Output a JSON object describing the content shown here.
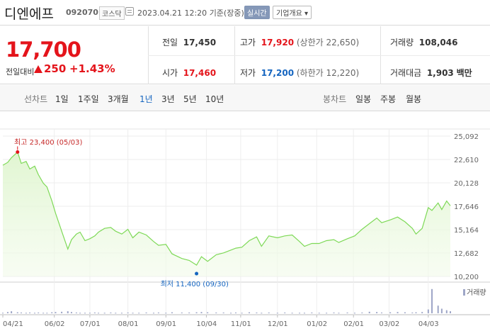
{
  "header": {
    "name": "디엔에프",
    "code": "092070",
    "market": "코스닥",
    "datetime": "2023.04.21 12:20",
    "basis": "기준(장중)",
    "live_label": "실시간",
    "info_label": "기업개요 ▾"
  },
  "quote": {
    "price": "17,700",
    "change_label": "전일대비",
    "change": "250",
    "change_pct": "+1.43%",
    "prev_label": "전일",
    "prev": "17,450",
    "high_label": "고가",
    "high": "17,920",
    "upper_limit": "(상한가 22,650)",
    "volume_label": "거래량",
    "volume": "108,046",
    "open_label": "시가",
    "open": "17,460",
    "low_label": "저가",
    "low": "17,200",
    "lower_limit": "(하한가 12,220)",
    "amount_label": "거래대금",
    "amount": "1,903",
    "amount_unit": "백만"
  },
  "tabs": {
    "line_label": "선차트",
    "periods": [
      "1일",
      "1주일",
      "3개월",
      "1년",
      "3년",
      "5년",
      "10년"
    ],
    "selected": "1년",
    "candle_label": "봉차트",
    "candles": [
      "일봉",
      "주봉",
      "월봉"
    ]
  },
  "colors": {
    "up": "#e4141b",
    "down": "#1565c0",
    "line": "#7ed957",
    "fill_top": "#dff5cf"
  },
  "chart_data": {
    "type": "area",
    "x_tick_labels": [
      "04/21",
      "06/02",
      "07/01",
      "08/01",
      "09/01",
      "10/04",
      "11/01",
      "12/01",
      "01/02",
      "02/01",
      "03/02",
      "04/03"
    ],
    "y_ticks": [
      10200,
      12682,
      15164,
      17646,
      20128,
      22610,
      25092
    ],
    "y_tick_labels": [
      "10,200",
      "12,682",
      "15,164",
      "17,646",
      "20,128",
      "22,610",
      "25,092"
    ],
    "ylim": [
      10200,
      25092
    ],
    "grid": true,
    "high_label": "최고 23,400 (05/03)",
    "low_label": "최저 11,400 (09/30)",
    "volume_legend": "거래량",
    "series": [
      {
        "x": [
          "2022-04-21",
          "2022-04-25",
          "2022-04-28",
          "2022-05-03",
          "2022-05-06",
          "2022-05-10",
          "2022-05-13",
          "2022-05-17",
          "2022-05-20",
          "2022-05-24",
          "2022-05-27",
          "2022-05-31",
          "2022-06-03",
          "2022-06-08",
          "2022-06-13",
          "2022-06-16",
          "2022-06-20",
          "2022-06-23",
          "2022-06-27",
          "2022-07-01",
          "2022-07-05",
          "2022-07-08",
          "2022-07-13",
          "2022-07-18",
          "2022-07-22",
          "2022-07-27",
          "2022-08-01",
          "2022-08-05",
          "2022-08-10",
          "2022-08-16",
          "2022-08-22",
          "2022-08-26",
          "2022-09-01",
          "2022-09-06",
          "2022-09-14",
          "2022-09-20",
          "2022-09-26",
          "2022-09-30",
          "2022-10-05",
          "2022-10-12",
          "2022-10-18",
          "2022-10-24",
          "2022-10-28",
          "2022-11-02",
          "2022-11-08",
          "2022-11-14",
          "2022-11-18",
          "2022-11-24",
          "2022-12-01",
          "2022-12-07",
          "2022-12-13",
          "2022-12-19",
          "2022-12-23",
          "2022-12-29",
          "2023-01-04",
          "2023-01-10",
          "2023-01-16",
          "2023-01-20",
          "2023-01-27",
          "2023-02-02",
          "2023-02-08",
          "2023-02-14",
          "2023-02-20",
          "2023-02-24",
          "2023-03-03",
          "2023-03-09",
          "2023-03-15",
          "2023-03-21",
          "2023-03-24",
          "2023-03-29",
          "2023-04-03",
          "2023-04-06",
          "2023-04-11",
          "2023-04-14",
          "2023-04-18",
          "2023-04-21"
        ],
        "y": [
          22000,
          22300,
          22800,
          23400,
          22200,
          22400,
          21600,
          21900,
          21000,
          20100,
          19700,
          18200,
          16900,
          15000,
          13100,
          14100,
          14700,
          14900,
          14000,
          14200,
          14500,
          14900,
          15300,
          15400,
          15000,
          14700,
          15200,
          14300,
          14900,
          14600,
          13900,
          13500,
          13600,
          12600,
          12100,
          11900,
          11400,
          12300,
          11800,
          12500,
          12700,
          13000,
          13200,
          13300,
          14000,
          14400,
          13400,
          14500,
          14300,
          14500,
          14600,
          13900,
          13400,
          13700,
          13700,
          14000,
          14100,
          13800,
          14200,
          14500,
          15200,
          15800,
          16400,
          15900,
          16200,
          16500,
          16000,
          15300,
          14700,
          15300,
          17500,
          17200,
          18000,
          17300,
          18200,
          17700
        ]
      }
    ],
    "volume": [
      0.02,
      0.05,
      0.08,
      0.04,
      0.03,
      0.02,
      0.03,
      0.02,
      0.03,
      0.02,
      0.02,
      0.04,
      0.05,
      0.06,
      0.08,
      0.05,
      0.03,
      0.02,
      0.02,
      0.02,
      0.03,
      0.02,
      0.02,
      0.03,
      0.02,
      0.02,
      0.03,
      0.02,
      0.02,
      0.03,
      0.02,
      0.03,
      0.02,
      0.04,
      0.03,
      0.03,
      0.04,
      0.05,
      0.04,
      0.03,
      0.03,
      0.02,
      0.03,
      0.02,
      0.04,
      0.03,
      0.02,
      0.03,
      0.02,
      0.03,
      0.02,
      0.02,
      0.02,
      0.03,
      0.02,
      0.02,
      0.03,
      0.02,
      0.03,
      0.02,
      0.03,
      0.06,
      0.05,
      0.03,
      0.04,
      0.05,
      0.04,
      0.03,
      0.04,
      0.05,
      0.15,
      0.95,
      0.3,
      0.18,
      0.12,
      0.08
    ]
  }
}
